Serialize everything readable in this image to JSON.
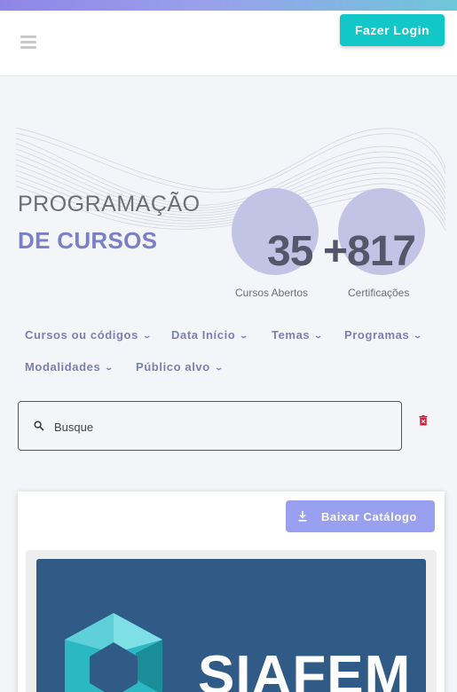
{
  "header": {
    "login_label": "Fazer Login"
  },
  "hero": {
    "title_line1": "PROGRAMAÇÃO",
    "title_line2": "DE CURSOS",
    "stats": [
      {
        "value": "35",
        "label": "Cursos Abertos"
      },
      {
        "value": "+817",
        "label": "Certificações"
      }
    ]
  },
  "filters": [
    {
      "label": "Cursos ou códigos"
    },
    {
      "label": "Data Início"
    },
    {
      "label": "Temas"
    },
    {
      "label": "Programas"
    },
    {
      "label": "Modalidades"
    },
    {
      "label": "Público alvo"
    }
  ],
  "search": {
    "placeholder": "Busque"
  },
  "catalog": {
    "download_label": "Baixar Catálogo",
    "course_logo_text": "SIAFEM"
  },
  "colors": {
    "accent_teal": "#12c7c7",
    "accent_purple": "#7b7fc6",
    "button_lavender": "#9aa0f0",
    "stat_circle": "#c3c3e6",
    "trash_red": "#d81b3a"
  },
  "icons": [
    "menu-icon",
    "chevron-down-icon",
    "search-icon",
    "trash-icon",
    "download-icon"
  ]
}
